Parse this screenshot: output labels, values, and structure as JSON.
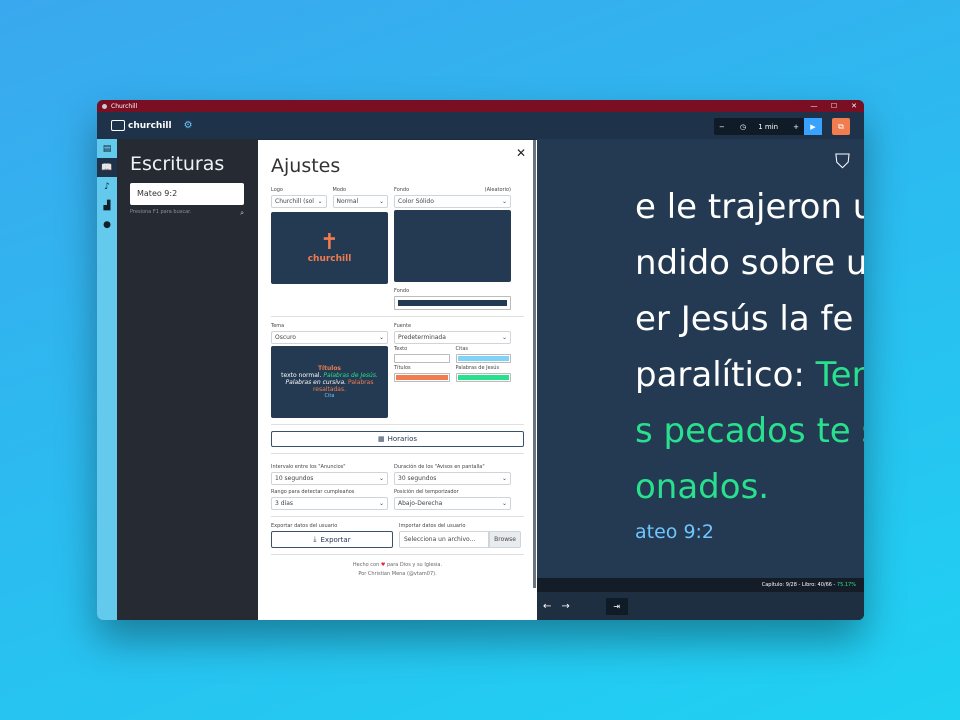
{
  "window": {
    "title": "Churchill",
    "controls": [
      "—",
      "☐",
      "✕"
    ]
  },
  "topbar": {
    "brand": "churchill",
    "timer_minus": "−",
    "timer_label": "1 min",
    "timer_plus": "+"
  },
  "rail": {
    "icons": [
      "layout-icon",
      "book-icon",
      "music-icon",
      "cake-icon",
      "palette-icon"
    ]
  },
  "sidebar": {
    "title": "Escrituras",
    "search_value": "Mateo 9:2",
    "hint": "Presiona F1 para buscar."
  },
  "viewer": {
    "lines": [
      "e le trajeron un",
      "ndido sobre una",
      "er Jesús la fe de",
      "paralítico:"
    ],
    "line4_green": "Ten",
    "green_lines": [
      "s pecados te son",
      "onados."
    ],
    "reference": "ateo 9:2",
    "status": "Capítulo: 9/28 - Libro: 40/66 - ",
    "status_pct": "75.17%"
  },
  "navbar": {
    "prev": "←",
    "next": "→",
    "end": "⇥"
  },
  "settings": {
    "title": "Ajustes",
    "logo_label": "Logo",
    "logo_value": "Churchill (sol",
    "mode_label": "Modo",
    "mode_value": "Normal",
    "bg_label": "Fondo",
    "bg_random": "(Aleatorio)",
    "bg_value": "Color Sólido",
    "logo_text": "churchill",
    "bg2_label": "Fondo",
    "theme_label": "Tema",
    "theme_value": "Oscuro",
    "font_label": "Fuente",
    "font_value": "Predeterminada",
    "text_label": "Texto",
    "cites_label": "Citas",
    "titles_label": "Títulos",
    "words_label": "Palabras de Jesús",
    "preview_title": "Títulos",
    "preview_normal": "texto normal.",
    "preview_words": "Palabras de Jesús.",
    "preview_italic": "Palabras en cursiva.",
    "preview_highlight": "Palabras resaltadas.",
    "preview_cite": "Cita",
    "schedule_button": "Horarios",
    "ads_interval_label": "Intervalo entre los \"Anuncios\"",
    "ads_interval_value": "10 segundos",
    "notice_duration_label": "Duración de los \"Avisos en pantalla\"",
    "notice_duration_value": "30 segundos",
    "birthday_label": "Rango para detectar cumpleaños",
    "birthday_value": "3 días",
    "timer_pos_label": "Posición del temporizador",
    "timer_pos_value": "Abajo-Derecha",
    "export_label": "Exportar datos del usuario",
    "export_button": "Exportar",
    "import_label": "Importar datos del usuario",
    "import_placeholder": "Selecciona un archivo...",
    "browse_button": "Browse",
    "footer_line1a": "Hecho con",
    "footer_line1b": "para Dios y su Iglesia.",
    "footer_line2": "Por Christian Mena (@vtam07)."
  },
  "colors": {
    "accent": "#39a2ff",
    "green": "#28e08d",
    "titles": "#f07c4f",
    "bg": "#243a52"
  }
}
